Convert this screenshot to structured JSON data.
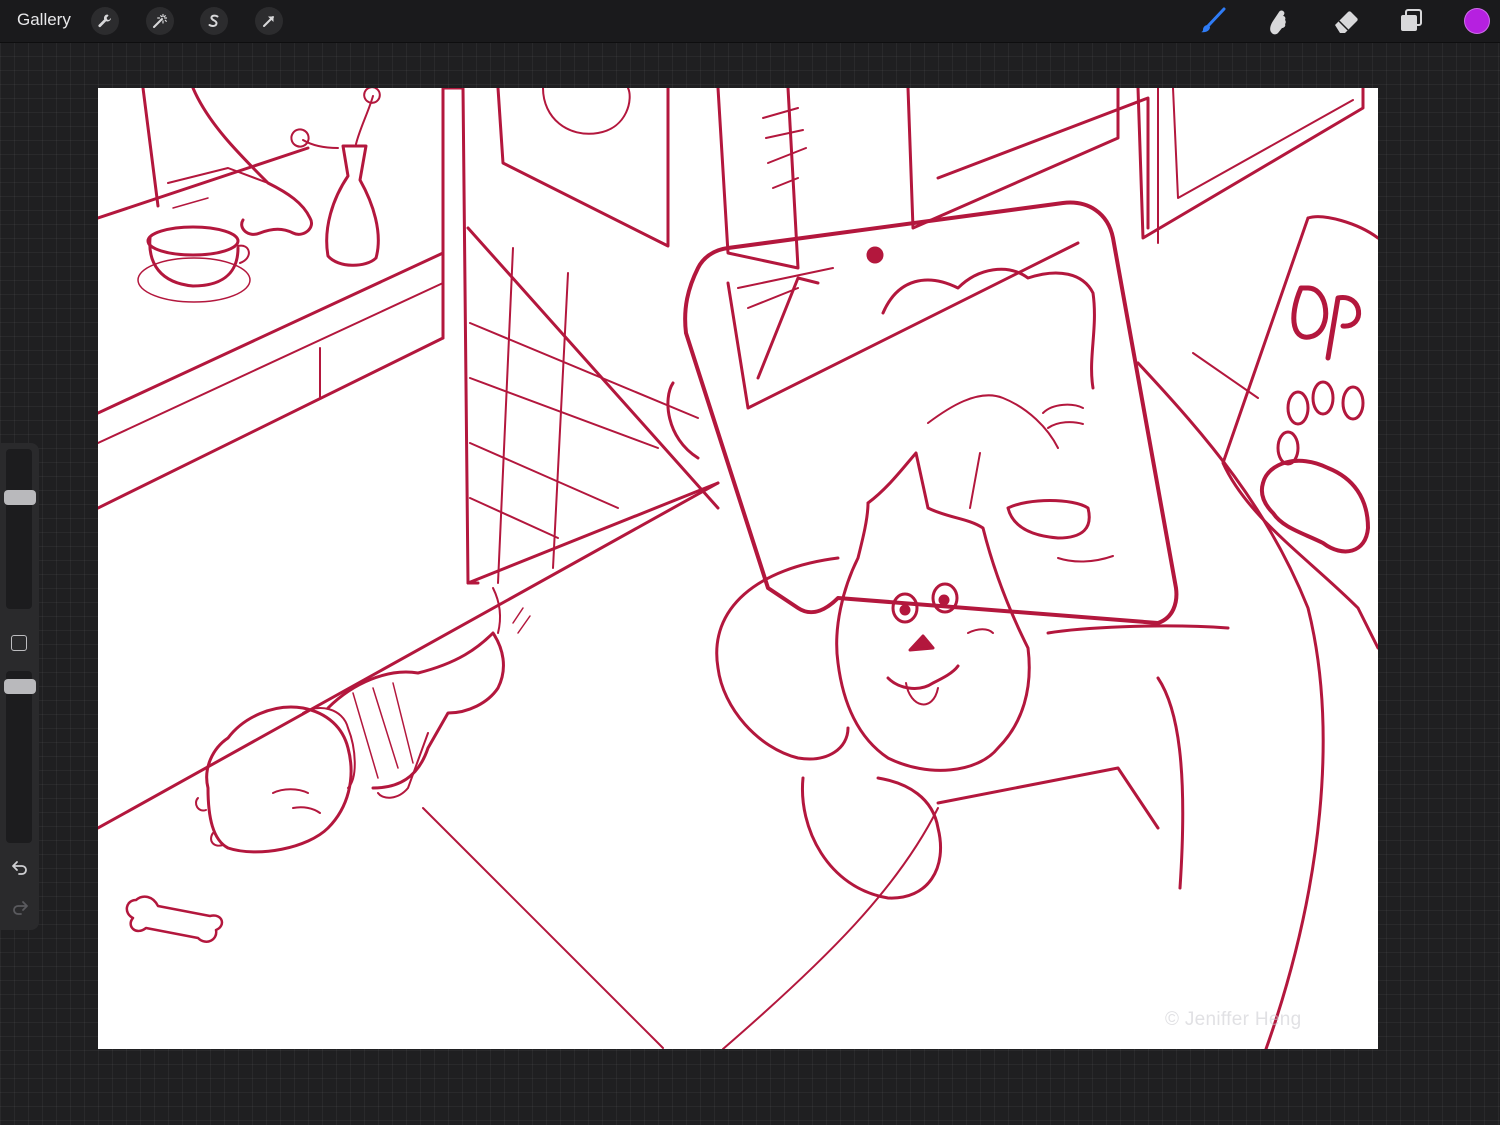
{
  "app": {
    "gallery_label": "Gallery"
  },
  "toolbar_left": [
    {
      "name": "actions",
      "icon": "wrench-icon"
    },
    {
      "name": "adjustments",
      "icon": "magic-wand-icon"
    },
    {
      "name": "selection",
      "icon": "selection-s-icon"
    },
    {
      "name": "transform",
      "icon": "arrow-cursor-icon"
    }
  ],
  "toolbar_right": [
    {
      "name": "brush",
      "icon": "brush-icon",
      "active": true
    },
    {
      "name": "smudge",
      "icon": "smudge-finger-icon"
    },
    {
      "name": "eraser",
      "icon": "eraser-icon"
    },
    {
      "name": "layers",
      "icon": "layers-icon"
    }
  ],
  "current_color": "#b620e0",
  "accent_active": "#2f7cf6",
  "sidebar": {
    "brush_size_level": 0.72,
    "opacity_level": 0.95,
    "undo_icon": "undo-arrow-icon",
    "redo_icon": "redo-arrow-icon",
    "modify_icon": "square-modify-icon"
  },
  "canvas": {
    "sketch_color": "#b3173d",
    "watermark": "© Jeniffer Heng",
    "sign_text": "OP"
  }
}
